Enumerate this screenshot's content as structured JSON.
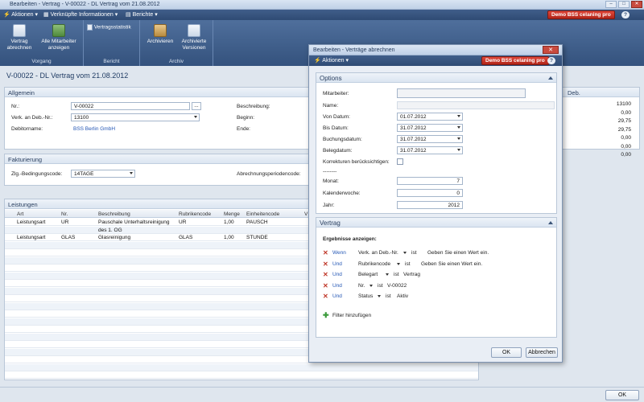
{
  "window": {
    "title": "Bearbeiten - Vertrag - V-00022 - DL Vertrag vom 21.08.2012"
  },
  "cmdbar": {
    "aktionen": "Aktionen",
    "verknuepfte": "Verknüpfte Informationen",
    "berichte": "Berichte",
    "badge": "Demo BSS celaning pro",
    "help": "?"
  },
  "ribbon": {
    "vorgang": {
      "label": "Vorgang",
      "buttons": [
        "Vertrag abrechnen",
        "Alle Mitarbeiter anzeigen"
      ]
    },
    "bericht": {
      "label": "Bericht",
      "buttons": [
        "Vertragsstatistik"
      ]
    },
    "archiv": {
      "label": "Archiv",
      "buttons": [
        "Archivieren",
        "Archivierte Versionen"
      ]
    }
  },
  "page_title": "V-00022 - DL Vertrag vom 21.08.2012",
  "allgemein": {
    "header": "Allgemein",
    "nr_label": "Nr.:",
    "nr_value": "V-00022",
    "verk_label": "Verk. an Deb.-Nr.:",
    "verk_value": "13100",
    "debitor_label": "Debitorname:",
    "debitor_value": "BSS Berlin GmbH",
    "beschreibung_label": "Beschreibung:",
    "beginn_label": "Beginn:",
    "ende_label": "Ende:",
    "ellipsis": "..."
  },
  "fakturierung": {
    "header": "Fakturierung",
    "zlg_label": "Zlg.-Bedingungscode:",
    "zlg_value": "14TAGE",
    "abr_label": "Abrechnungsperiodencode:"
  },
  "leistungen": {
    "header": "Leistungen",
    "columns": [
      "Art",
      "Nr.",
      "Beschreibung",
      "Rubrikencode",
      "Menge",
      "Einheitencode",
      "V"
    ],
    "rows": [
      [
        "Leistungsart",
        "UR",
        "Pauschale Unterhaltsreinigung",
        "UR",
        "1,00",
        "PAUSCH",
        ""
      ],
      [
        "",
        "",
        "des 1. OG",
        "",
        "",
        "",
        ""
      ],
      [
        "Leistungsart",
        "GLAS",
        "Glasreinigung",
        "GLAS",
        "1,00",
        "STUNDE",
        ""
      ]
    ]
  },
  "right_panel": {
    "header": "Deb.",
    "values": [
      "13100",
      "0,00",
      "29,75",
      "29,75",
      "0,00",
      "0,00",
      "0,00"
    ]
  },
  "dialog": {
    "title": "Bearbeiten - Verträge abrechnen",
    "aktionen": "Aktionen",
    "badge": "Demo BSS celaning pro",
    "help": "?",
    "options": {
      "header": "Options",
      "mitarbeiter_label": "Mitarbeiter:",
      "name_label": "Name:",
      "von_label": "Von Datum:",
      "von_value": "01.07.2012",
      "bis_label": "Bis Datum:",
      "bis_value": "31.07.2012",
      "buchung_label": "Buchungsdatum:",
      "buchung_value": "31.07.2012",
      "beleg_label": "Belegdatum:",
      "beleg_value": "31.07.2012",
      "korrekturen_label": "Korrekturen berücksichtigen:",
      "separator": "--------",
      "monat_label": "Monat:",
      "monat_value": "7",
      "kw_label": "Kalenderwoche:",
      "kw_value": "0",
      "jahr_label": "Jahr:",
      "jahr_value": "2012"
    },
    "vertrag": {
      "header": "Vertrag",
      "ergebnisse": "Ergebnisse anzeigen:",
      "filters": [
        {
          "conj": "Wenn",
          "field": "Verk. an Deb.-Nr.",
          "op": "ist",
          "value": "Geben Sie einen Wert ein."
        },
        {
          "conj": "Und",
          "field": "Rubrikencode",
          "op": "ist",
          "value": "Geben Sie einen Wert ein."
        },
        {
          "conj": "Und",
          "field": "Belegart",
          "op": "ist",
          "value": "Vertrag"
        },
        {
          "conj": "Und",
          "field": "Nr.",
          "op": "ist",
          "value": "V-00022"
        },
        {
          "conj": "Und",
          "field": "Status",
          "op": "ist",
          "value": "Aktiv"
        }
      ],
      "add_filter": "Filter hinzufügen"
    },
    "ok": "OK",
    "abbrechen": "Abbrechen"
  },
  "statusbar": {
    "ok": "OK"
  },
  "colors": {
    "ribbon": "#3f5f8c",
    "badge": "#c9342a",
    "link": "#2356b5"
  }
}
